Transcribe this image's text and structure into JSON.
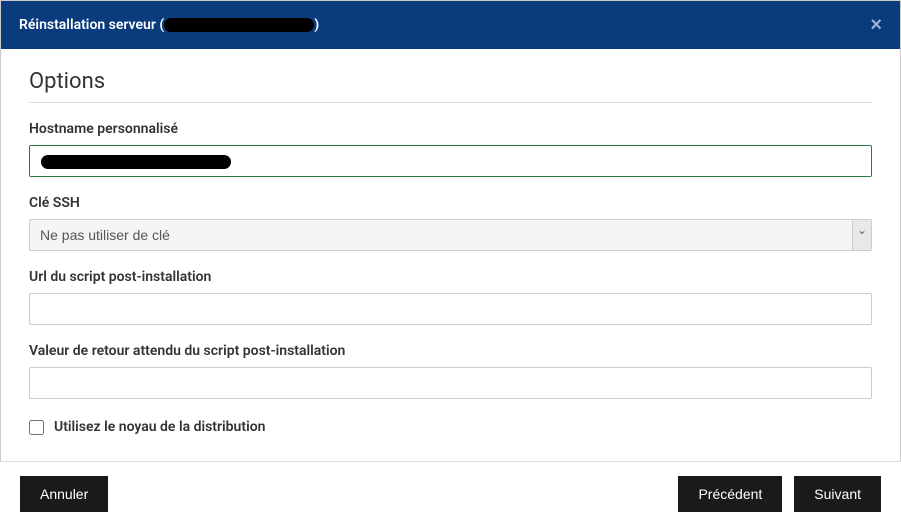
{
  "header": {
    "title_prefix": "Réinstallation serveur (",
    "title_suffix": ")",
    "redacted_server": "████████████████"
  },
  "section": {
    "title": "Options"
  },
  "form": {
    "hostname": {
      "label": "Hostname personnalisé",
      "value": "██████████████████"
    },
    "ssh_key": {
      "label": "Clé SSH",
      "selected": "Ne pas utiliser de clé"
    },
    "post_install_url": {
      "label": "Url du script post-installation",
      "value": ""
    },
    "post_install_return": {
      "label": "Valeur de retour attendu du script post-installation",
      "value": ""
    },
    "use_kernel": {
      "label": "Utilisez le noyau de la distribution",
      "checked": false
    }
  },
  "footer": {
    "cancel": "Annuler",
    "previous": "Précédent",
    "next": "Suivant"
  }
}
